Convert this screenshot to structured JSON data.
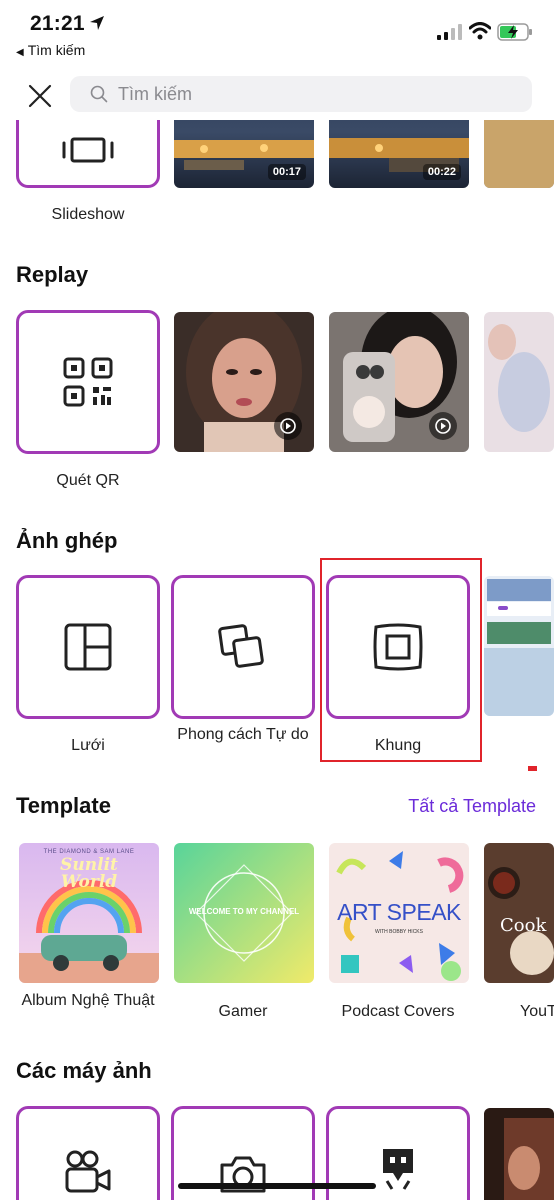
{
  "status_bar": {
    "time": "21:21",
    "back_app_label": "Tìm kiếm"
  },
  "search": {
    "placeholder": "Tìm kiếm"
  },
  "sections": {
    "slideshow": {
      "tile_label": "Slideshow",
      "videos": [
        {
          "duration": "00:17"
        },
        {
          "duration": "00:22"
        }
      ]
    },
    "replay": {
      "title": "Replay",
      "tile_label": "Quét QR"
    },
    "collage": {
      "title": "Ảnh ghép",
      "tiles": [
        {
          "label": "Lưới"
        },
        {
          "label": "Phong cách Tự do"
        },
        {
          "label": "Khung"
        }
      ]
    },
    "template": {
      "title": "Template",
      "see_all": "Tất cả Template",
      "items": [
        {
          "label": "Album Nghệ Thuật",
          "art_text": "Sunlit World",
          "art_top": "THE DIAMOND & SAM LANE"
        },
        {
          "label": "Gamer",
          "art_text": "WELCOME TO MY CHANNEL"
        },
        {
          "label": "Podcast Covers",
          "art_text": "ART SPEAK",
          "art_sub": "WITH BOBBY HICKS"
        },
        {
          "label": "YouT",
          "art_text": "Cook"
        }
      ]
    },
    "cameras": {
      "title": "Các máy ảnh"
    }
  },
  "colors": {
    "accent_border": "#a13ab5",
    "link": "#6b2bd9",
    "highlight": "#e0242b"
  }
}
